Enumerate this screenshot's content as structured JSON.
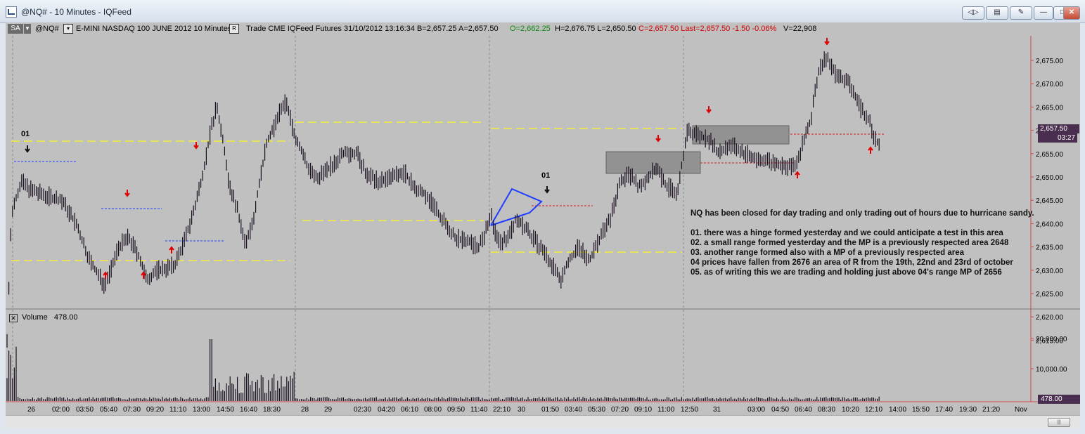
{
  "window": {
    "title": "@NQ# - 10 Minutes - IQFeed"
  },
  "toolbar": {
    "mode": "SA",
    "symbol": "@NQ#",
    "description": "E-MINI NASDAQ 100 JUNE 2012  10 Minutes",
    "r_label": "R",
    "info": "Trade  CME  IQFeed  Futures  31/10/2012  13:16:34  B=2,657.25  A=2,657.50",
    "open": "O=2,662.25",
    "hlc": "H=2,676.75  L=2,650.50",
    "close_last": "C=2,657.50  Last=2,657.50  -1.50  -0.06%",
    "volume": "V=22,908"
  },
  "price_axis": {
    "labels": [
      "2,675.00",
      "2,670.00",
      "2,665.00",
      "2,660.00",
      "2,655.00",
      "2,650.00",
      "2,645.00",
      "2,640.00",
      "2,635.00",
      "2,630.00",
      "2,625.00",
      "2,620.00",
      "2,615.00"
    ],
    "current_price": "2,657.50",
    "bar_timer": "03:27"
  },
  "volume_panel": {
    "label": "Volume",
    "value": "478.00",
    "axis_labels": [
      "20,000.00",
      "10,000.00"
    ],
    "current": "478.00"
  },
  "time_axis": {
    "labels": [
      "26",
      "02:00",
      "03:50",
      "05:40",
      "07:30",
      "09:20",
      "11:10",
      "13:00",
      "14:50",
      "16:40",
      "18:30",
      "28",
      "29",
      "02:30",
      "04:20",
      "06:10",
      "08:00",
      "09:50",
      "11:40",
      "22:10",
      "30",
      "01:50",
      "03:40",
      "05:30",
      "07:20",
      "09:10",
      "11:00",
      "12:50",
      "31",
      "03:00",
      "04:50",
      "06:40",
      "08:30",
      "10:20",
      "12:10",
      "14:00",
      "15:50",
      "17:40",
      "19:30",
      "21:20",
      "Nov"
    ]
  },
  "annotations": {
    "label_01_a": "01",
    "label_01_b": "01",
    "notes": [
      "NQ has been closed for day trading and only trading out of hours due to hurricane sandy.",
      "",
      "01. there was a hinge formed yesterday and we could anticipate a test in this area",
      "02. a small range formed yesterday and the MP is a previously respected area 2648",
      "03. another range formed also with a MP of a previously respected area",
      "04 prices have fallen from 2676 an area of R from the 19th, 22nd and 23rd of october",
      "05. as of writing this we are trading and holding just above 04's range MP of 2656"
    ]
  },
  "colors": {
    "chart_bg": "#c0c0c0",
    "bar": "#1a0f1f",
    "yellow_line": "#f2ef3c",
    "red_arrow": "#e00000",
    "blue_line": "#1f3cff",
    "badge": "#4a2e4f"
  }
}
